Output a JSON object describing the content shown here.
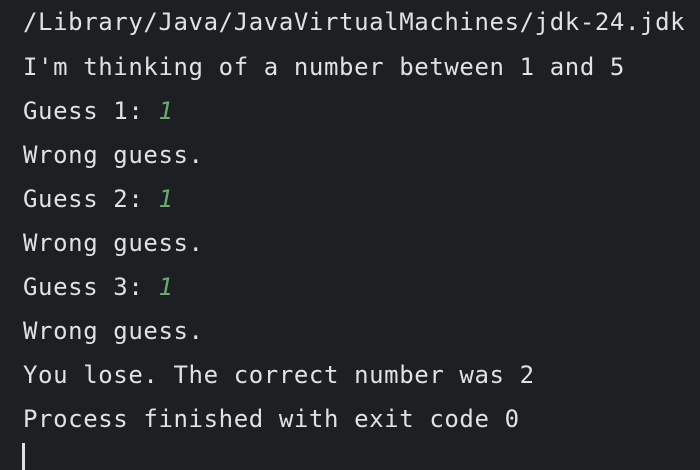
{
  "console": {
    "command_line": "/Library/Java/JavaVirtualMachines/jdk-24.jdk",
    "intro": "I'm thinking of a number between 1 and 5",
    "rounds": [
      {
        "prompt": "Guess 1: ",
        "input": "1",
        "result": "Wrong guess."
      },
      {
        "prompt": "Guess 2: ",
        "input": "1",
        "result": "Wrong guess."
      },
      {
        "prompt": "Guess 3: ",
        "input": "1",
        "result": "Wrong guess."
      }
    ],
    "outcome": "You lose. The correct number was 2",
    "exit_message": "Process finished with exit code 0"
  },
  "colors": {
    "background": "#1e1f22",
    "text": "#dfe1e5",
    "user_input": "#6aab73"
  }
}
